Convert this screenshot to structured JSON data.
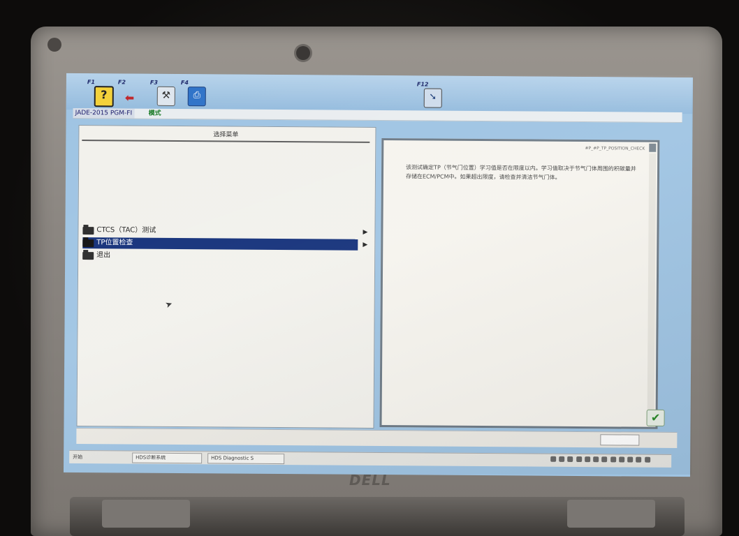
{
  "toolbar": {
    "keys": [
      {
        "label": "F1",
        "icon": "help-icon"
      },
      {
        "label": "F2",
        "icon": "back-icon"
      },
      {
        "label": "F3",
        "icon": "tools-icon"
      },
      {
        "label": "F4",
        "icon": "print-icon"
      },
      {
        "label": "F12",
        "icon": "next-icon"
      }
    ]
  },
  "status": {
    "vehicle": "JADE-2015 PGM-FI",
    "mode": "模式"
  },
  "left_panel": {
    "header": "选择菜单",
    "items": [
      {
        "label": "CTCS（TAC）测试",
        "selected": false,
        "has_submenu": true
      },
      {
        "label": "TP位置检查",
        "selected": true,
        "has_submenu": true
      },
      {
        "label": "退出",
        "selected": false,
        "has_submenu": false
      }
    ]
  },
  "right_panel": {
    "code": "#P_#P_TP_POSITION_CHECK",
    "description": "该测试确定TP（节气门位置）学习值是否在限度以内。学习值取决于节气门体周围的积碳量并存储在ECM/PCM中。如果超出限度，请检查并清洁节气门体。"
  },
  "taskbar": {
    "start": "开始",
    "tasks": [
      "HDS诊断系统",
      "HDS Diagnostic S"
    ]
  },
  "colors": {
    "selection": "#13307a",
    "toolbar": "#a8c8e6",
    "mode_text": "#1a7a26"
  }
}
